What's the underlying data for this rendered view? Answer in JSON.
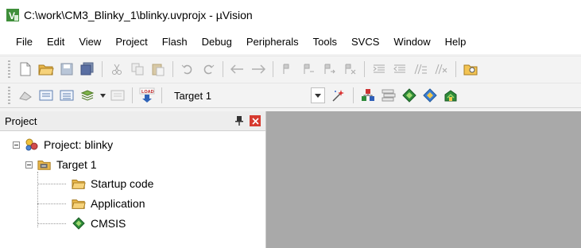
{
  "window": {
    "title": "C:\\work\\CM3_Blinky_1\\blinky.uvprojx - µVision",
    "app_icon": "uvision-logo-icon"
  },
  "menu": {
    "items": [
      "File",
      "Edit",
      "View",
      "Project",
      "Flash",
      "Debug",
      "Peripherals",
      "Tools",
      "SVCS",
      "Window",
      "Help"
    ]
  },
  "build_toolbar": {
    "target_selected": "Target 1"
  },
  "project_panel": {
    "title": "Project",
    "tree": {
      "root_label": "Project: blinky",
      "target_label": "Target 1",
      "groups": [
        {
          "label": "Startup code",
          "icon": "folder-icon"
        },
        {
          "label": "Application",
          "icon": "folder-icon"
        },
        {
          "label": "CMSIS",
          "icon": "cmsis-component-icon"
        }
      ]
    }
  },
  "colors": {
    "editor_background": "#a9a9a9",
    "close_button": "#d63a2f",
    "folder": "#e8b64a"
  }
}
